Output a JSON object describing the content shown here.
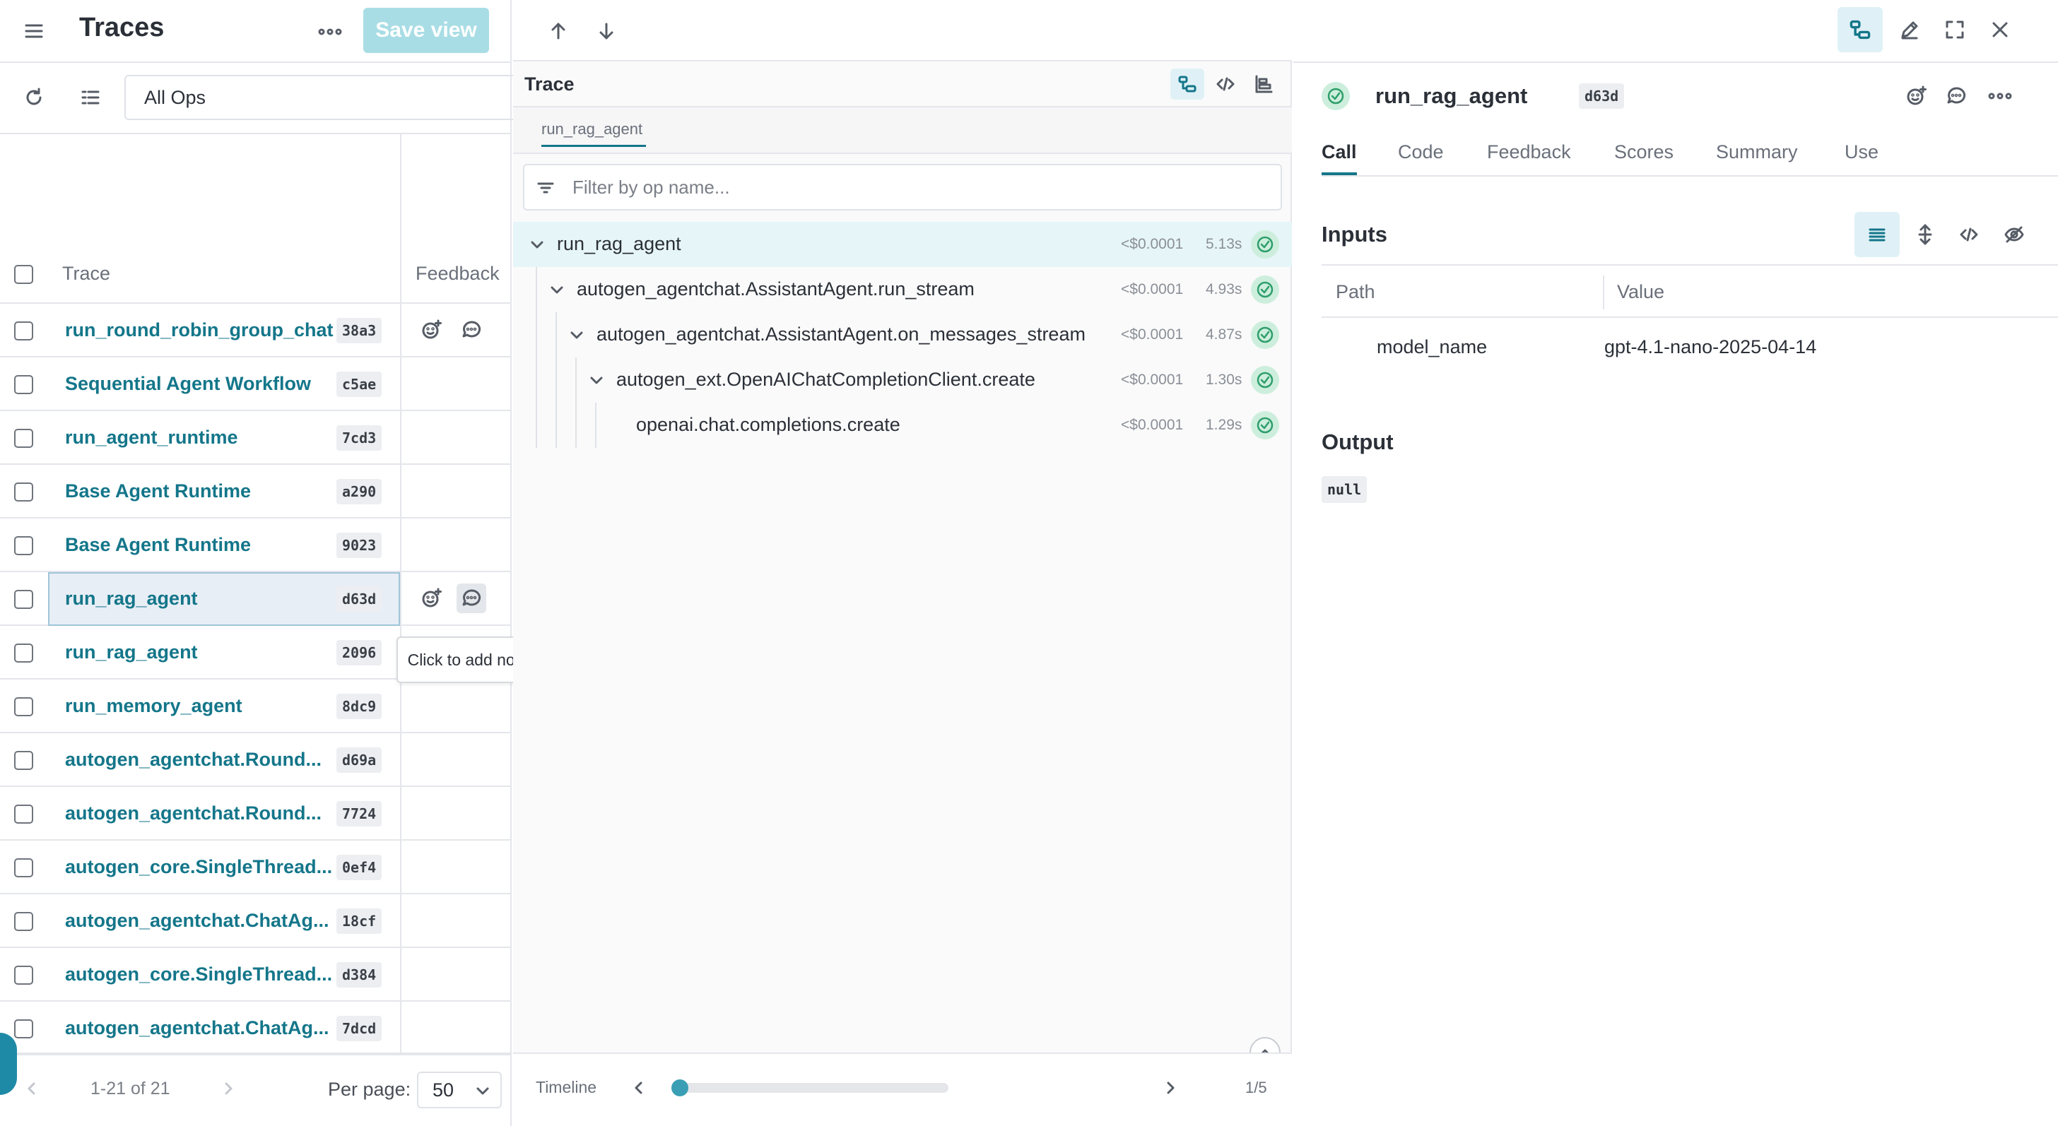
{
  "left": {
    "title": "Traces",
    "save_view_label": "Save view",
    "ops_filter_value": "All Ops",
    "columns": {
      "trace": "Trace",
      "feedback": "Feedback"
    },
    "rows": [
      {
        "name": "run_round_robin_group_chat",
        "hash": "38a3"
      },
      {
        "name": "Sequential Agent Workflow",
        "hash": "c5ae"
      },
      {
        "name": "run_agent_runtime",
        "hash": "7cd3"
      },
      {
        "name": "Base Agent Runtime",
        "hash": "a290"
      },
      {
        "name": "Base Agent Runtime",
        "hash": "9023"
      },
      {
        "name": "run_rag_agent",
        "hash": "d63d"
      },
      {
        "name": "run_rag_agent",
        "hash": "2096"
      },
      {
        "name": "run_memory_agent",
        "hash": "8dc9"
      },
      {
        "name": "autogen_agentchat.Round...",
        "hash": "d69a"
      },
      {
        "name": "autogen_agentchat.Round...",
        "hash": "7724"
      },
      {
        "name": "autogen_core.SingleThread...",
        "hash": "0ef4"
      },
      {
        "name": "autogen_agentchat.ChatAg...",
        "hash": "18cf"
      },
      {
        "name": "autogen_core.SingleThread...",
        "hash": "d384"
      },
      {
        "name": "autogen_agentchat.ChatAg...",
        "hash": "7dcd"
      }
    ],
    "tooltip": "Click to add notes",
    "pager_text": "1-21 of 21",
    "per_page_label": "Per page:",
    "per_page_value": "50"
  },
  "middle": {
    "title": "Trace",
    "tab_label": "run_rag_agent",
    "filter_placeholder": "Filter by op name...",
    "tree": [
      {
        "name": "run_rag_agent",
        "cost": "<$0.0001",
        "duration": "5.13s",
        "depth": 0
      },
      {
        "name": "autogen_agentchat.AssistantAgent.run_stream",
        "cost": "<$0.0001",
        "duration": "4.93s",
        "depth": 1
      },
      {
        "name": "autogen_agentchat.AssistantAgent.on_messages_stream",
        "cost": "<$0.0001",
        "duration": "4.87s",
        "depth": 2
      },
      {
        "name": "autogen_ext.OpenAIChatCompletionClient.create",
        "cost": "<$0.0001",
        "duration": "1.30s",
        "depth": 3
      },
      {
        "name": "openai.chat.completions.create",
        "cost": "<$0.0001",
        "duration": "1.29s",
        "depth": 4
      }
    ],
    "timeline_label": "Timeline",
    "timeline_count": "1/5"
  },
  "right": {
    "title": "run_rag_agent",
    "hash": "d63d",
    "tabs": [
      "Call",
      "Code",
      "Feedback",
      "Scores",
      "Summary",
      "Use"
    ],
    "inputs_title": "Inputs",
    "table_headers": {
      "path": "Path",
      "value": "Value"
    },
    "input_rows": [
      {
        "path": "model_name",
        "value": "gpt-4.1-nano-2025-04-14"
      }
    ],
    "output_title": "Output",
    "output_value": "null"
  },
  "colors": {
    "accent": "#14768a",
    "save_view_bg": "#a9dde5",
    "success": "#2e9e6a",
    "selected_row": "#e6f5f8"
  },
  "icons": [
    "menu-icon",
    "more-horizontal-icon",
    "refresh-icon",
    "columns-icon",
    "arrow-up-icon",
    "arrow-down-icon",
    "trace-tree-icon",
    "code-icon",
    "timeline-icon",
    "edit-icon",
    "fullscreen-icon",
    "close-icon",
    "emoji-add-icon",
    "note-icon",
    "check-circle-icon",
    "filter-icon",
    "chevron-down-icon",
    "chevron-left-icon",
    "chevron-right-icon",
    "chevron-up-icon",
    "list-view-icon",
    "expand-vertical-icon",
    "hide-icon"
  ]
}
